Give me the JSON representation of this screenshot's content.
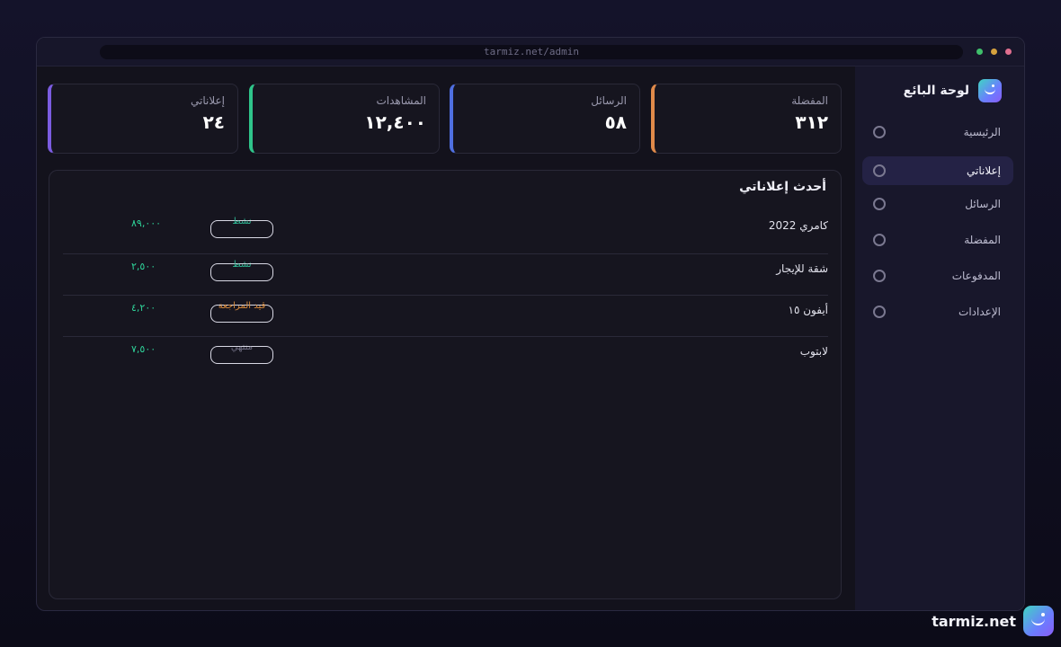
{
  "browser": {
    "url": "tarmiz.net/admin"
  },
  "sidebar": {
    "title": "لوحة البائع",
    "logo_icon": "smile-logo-icon",
    "items": [
      {
        "label": "الرئيسية",
        "active": false
      },
      {
        "label": "إعلاناتي",
        "active": true
      },
      {
        "label": "الرسائل",
        "active": false
      },
      {
        "label": "المفضلة",
        "active": false
      },
      {
        "label": "المدفوعات",
        "active": false
      },
      {
        "label": "الإعدادات",
        "active": false
      }
    ]
  },
  "stats": [
    {
      "label": "المفضلة",
      "value": "٣١٢",
      "color": "#e08a4a"
    },
    {
      "label": "الرسائل",
      "value": "٥٨",
      "color": "#4f6fe0"
    },
    {
      "label": "المشاهدات",
      "value": "١٢,٤٠٠",
      "color": "#2fc48a"
    },
    {
      "label": "إعلاناتي",
      "value": "٢٤",
      "color": "#7b5ce0"
    }
  ],
  "listings": {
    "title": "أحدث إعلاناتي",
    "rows": [
      {
        "name": "كامري 2022",
        "status": "نشط",
        "status_color": "#2fb894",
        "price": "٨٩,٠٠٠"
      },
      {
        "name": "شقة للإيجار",
        "status": "نشط",
        "status_color": "#2fb894",
        "price": "٢,٥٠٠"
      },
      {
        "name": "أيفون ١٥",
        "status": "قيد المراجعة",
        "status_color": "#d88a3a",
        "price": "٤,٢٠٠"
      },
      {
        "name": "لابتوب",
        "status": "منتهي",
        "status_color": "#6e6c80",
        "price": "٧,٥٠٠"
      }
    ]
  },
  "footer": {
    "brand": "tarmiz.net"
  }
}
